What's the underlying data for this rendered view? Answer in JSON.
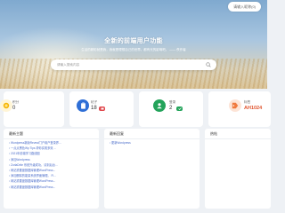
{
  "header": {
    "user_label": "请输入昵称(0)"
  },
  "hero": {
    "title": "全新的前端用户功能",
    "subtitle": "生活的精彩就是我，我就是理想自己的世界。都有光的影响吧。 —— 佚作者",
    "search_placeholder": "请输入搜索内容"
  },
  "stats": [
    {
      "label": "积分",
      "value": "0",
      "icon": "coin-icon",
      "color": "#f5b400"
    },
    {
      "label": "帖子",
      "value": "18",
      "icon": "clipboard-icon",
      "color": "#2f6fd6",
      "tag_color": "#e0474c"
    },
    {
      "label": "登录",
      "value": "2",
      "icon": "person-icon",
      "color": "#23a35a",
      "tag_color": "#23a35a"
    },
    {
      "label": "标签",
      "value": "AH1024",
      "icon": "tag-icon",
      "color": "#f07a3e"
    }
  ],
  "panels": {
    "latest": {
      "title": "最新主题",
      "items": [
        "Wordpress新版Reveal门户用户登录界...",
        "一点点黑色Wp Tips 帮你实现多效 ...",
        "2021年前端学习路线图",
        "添加Wordpress",
        "ZorlaDrite 系统升级成功，请到后台...",
        "网站重要度数据库管理WordPress...",
        "添加删除的能量系统界面管理。 Fi...",
        "网站重要度数据库管理WordPress...",
        "网站重要度数据库管理WordPress..."
      ]
    },
    "recent": {
      "title": "最新回复",
      "items": [
        "更新Wordpress"
      ]
    },
    "other": {
      "title": "热帖"
    }
  }
}
